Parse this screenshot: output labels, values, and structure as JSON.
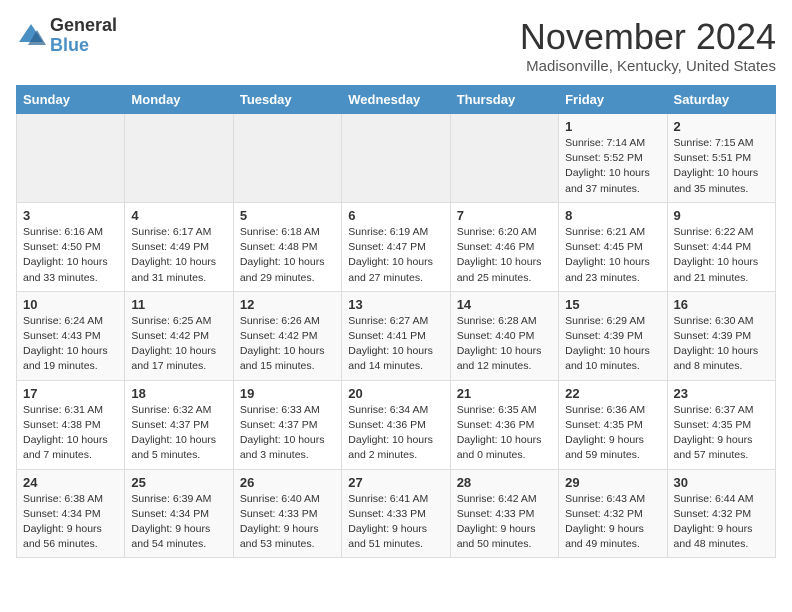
{
  "header": {
    "logo_general": "General",
    "logo_blue": "Blue",
    "month_title": "November 2024",
    "location": "Madisonville, Kentucky, United States"
  },
  "days_of_week": [
    "Sunday",
    "Monday",
    "Tuesday",
    "Wednesday",
    "Thursday",
    "Friday",
    "Saturday"
  ],
  "weeks": [
    [
      {
        "day": "",
        "info": ""
      },
      {
        "day": "",
        "info": ""
      },
      {
        "day": "",
        "info": ""
      },
      {
        "day": "",
        "info": ""
      },
      {
        "day": "",
        "info": ""
      },
      {
        "day": "1",
        "info": "Sunrise: 7:14 AM\nSunset: 5:52 PM\nDaylight: 10 hours and 37 minutes."
      },
      {
        "day": "2",
        "info": "Sunrise: 7:15 AM\nSunset: 5:51 PM\nDaylight: 10 hours and 35 minutes."
      }
    ],
    [
      {
        "day": "3",
        "info": "Sunrise: 6:16 AM\nSunset: 4:50 PM\nDaylight: 10 hours and 33 minutes."
      },
      {
        "day": "4",
        "info": "Sunrise: 6:17 AM\nSunset: 4:49 PM\nDaylight: 10 hours and 31 minutes."
      },
      {
        "day": "5",
        "info": "Sunrise: 6:18 AM\nSunset: 4:48 PM\nDaylight: 10 hours and 29 minutes."
      },
      {
        "day": "6",
        "info": "Sunrise: 6:19 AM\nSunset: 4:47 PM\nDaylight: 10 hours and 27 minutes."
      },
      {
        "day": "7",
        "info": "Sunrise: 6:20 AM\nSunset: 4:46 PM\nDaylight: 10 hours and 25 minutes."
      },
      {
        "day": "8",
        "info": "Sunrise: 6:21 AM\nSunset: 4:45 PM\nDaylight: 10 hours and 23 minutes."
      },
      {
        "day": "9",
        "info": "Sunrise: 6:22 AM\nSunset: 4:44 PM\nDaylight: 10 hours and 21 minutes."
      }
    ],
    [
      {
        "day": "10",
        "info": "Sunrise: 6:24 AM\nSunset: 4:43 PM\nDaylight: 10 hours and 19 minutes."
      },
      {
        "day": "11",
        "info": "Sunrise: 6:25 AM\nSunset: 4:42 PM\nDaylight: 10 hours and 17 minutes."
      },
      {
        "day": "12",
        "info": "Sunrise: 6:26 AM\nSunset: 4:42 PM\nDaylight: 10 hours and 15 minutes."
      },
      {
        "day": "13",
        "info": "Sunrise: 6:27 AM\nSunset: 4:41 PM\nDaylight: 10 hours and 14 minutes."
      },
      {
        "day": "14",
        "info": "Sunrise: 6:28 AM\nSunset: 4:40 PM\nDaylight: 10 hours and 12 minutes."
      },
      {
        "day": "15",
        "info": "Sunrise: 6:29 AM\nSunset: 4:39 PM\nDaylight: 10 hours and 10 minutes."
      },
      {
        "day": "16",
        "info": "Sunrise: 6:30 AM\nSunset: 4:39 PM\nDaylight: 10 hours and 8 minutes."
      }
    ],
    [
      {
        "day": "17",
        "info": "Sunrise: 6:31 AM\nSunset: 4:38 PM\nDaylight: 10 hours and 7 minutes."
      },
      {
        "day": "18",
        "info": "Sunrise: 6:32 AM\nSunset: 4:37 PM\nDaylight: 10 hours and 5 minutes."
      },
      {
        "day": "19",
        "info": "Sunrise: 6:33 AM\nSunset: 4:37 PM\nDaylight: 10 hours and 3 minutes."
      },
      {
        "day": "20",
        "info": "Sunrise: 6:34 AM\nSunset: 4:36 PM\nDaylight: 10 hours and 2 minutes."
      },
      {
        "day": "21",
        "info": "Sunrise: 6:35 AM\nSunset: 4:36 PM\nDaylight: 10 hours and 0 minutes."
      },
      {
        "day": "22",
        "info": "Sunrise: 6:36 AM\nSunset: 4:35 PM\nDaylight: 9 hours and 59 minutes."
      },
      {
        "day": "23",
        "info": "Sunrise: 6:37 AM\nSunset: 4:35 PM\nDaylight: 9 hours and 57 minutes."
      }
    ],
    [
      {
        "day": "24",
        "info": "Sunrise: 6:38 AM\nSunset: 4:34 PM\nDaylight: 9 hours and 56 minutes."
      },
      {
        "day": "25",
        "info": "Sunrise: 6:39 AM\nSunset: 4:34 PM\nDaylight: 9 hours and 54 minutes."
      },
      {
        "day": "26",
        "info": "Sunrise: 6:40 AM\nSunset: 4:33 PM\nDaylight: 9 hours and 53 minutes."
      },
      {
        "day": "27",
        "info": "Sunrise: 6:41 AM\nSunset: 4:33 PM\nDaylight: 9 hours and 51 minutes."
      },
      {
        "day": "28",
        "info": "Sunrise: 6:42 AM\nSunset: 4:33 PM\nDaylight: 9 hours and 50 minutes."
      },
      {
        "day": "29",
        "info": "Sunrise: 6:43 AM\nSunset: 4:32 PM\nDaylight: 9 hours and 49 minutes."
      },
      {
        "day": "30",
        "info": "Sunrise: 6:44 AM\nSunset: 4:32 PM\nDaylight: 9 hours and 48 minutes."
      }
    ]
  ]
}
